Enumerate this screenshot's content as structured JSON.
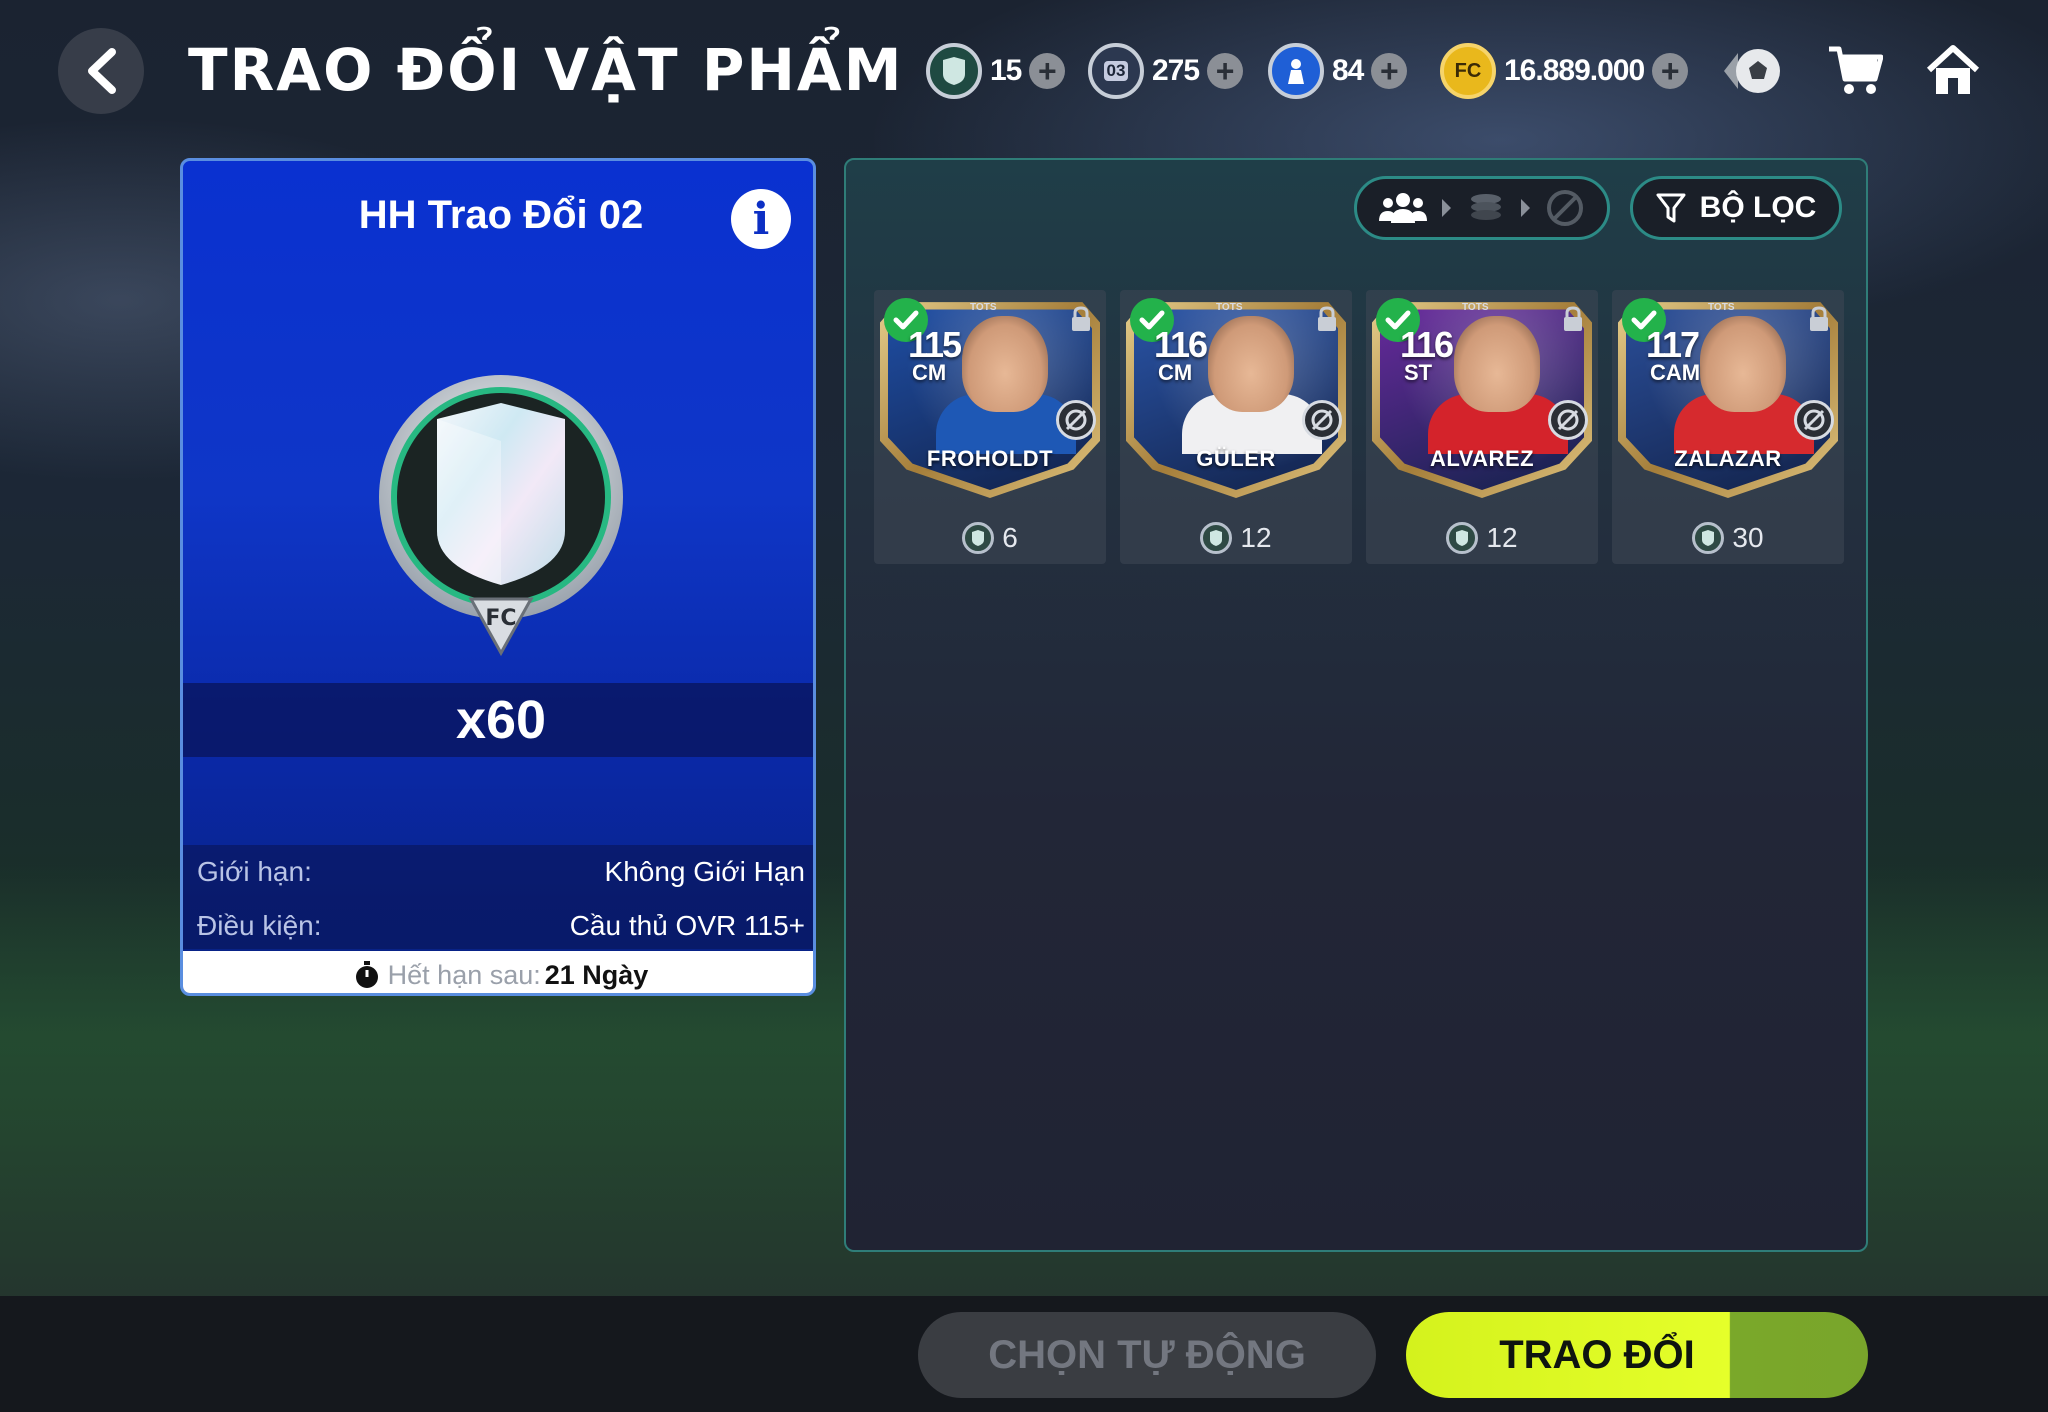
{
  "header": {
    "title": "TRAO ĐỔI VẬT PHẨM",
    "currencies": [
      {
        "icon": "shield-token-icon",
        "value": "15"
      },
      {
        "icon": "card-03-icon",
        "value": "275"
      },
      {
        "icon": "player-token-icon",
        "value": "84"
      },
      {
        "icon": "fc-coin-icon",
        "value": "16.889.000"
      }
    ],
    "nav_icons": [
      "ball-icon",
      "cart-icon",
      "home-icon"
    ]
  },
  "left_panel": {
    "title": "HH Trao Đổi 02",
    "quantity": "x60",
    "rows": [
      {
        "label": "Giới hạn:",
        "value": "Không Giới Hạn"
      },
      {
        "label": "Điều kiện:",
        "value": "Cầu thủ OVR 115+"
      }
    ],
    "expire_label": "Hết hạn sau:",
    "expire_value": "21 Ngày"
  },
  "right_panel": {
    "filter_label": "BỘ LỌC",
    "cards": [
      {
        "name": "FROHOLDT",
        "ovr": "115",
        "position": "CM",
        "badge": "TOTS",
        "cost": "6",
        "selected": true,
        "bg": "#1f4fa6",
        "kit": "#1e58b5"
      },
      {
        "name": "GÜLER",
        "ovr": "116",
        "position": "CM",
        "badge": "TOTS",
        "cost": "12",
        "selected": true,
        "bg": "#2a55a8",
        "kit": "#f0f0f2"
      },
      {
        "name": "ALVAREZ",
        "ovr": "116",
        "position": "ST",
        "badge": "TOTS",
        "cost": "12",
        "selected": true,
        "bg": "#6a2a9e",
        "kit": "#d4232b"
      },
      {
        "name": "ZALAZAR",
        "ovr": "117",
        "position": "CAM",
        "badge": "TOTS",
        "cost": "30",
        "selected": true,
        "bg": "#2b4f9a",
        "kit": "#d62a2e"
      }
    ]
  },
  "footer": {
    "auto_label": "CHỌN TỰ ĐỘNG",
    "trade_label": "TRAO ĐỔI"
  }
}
